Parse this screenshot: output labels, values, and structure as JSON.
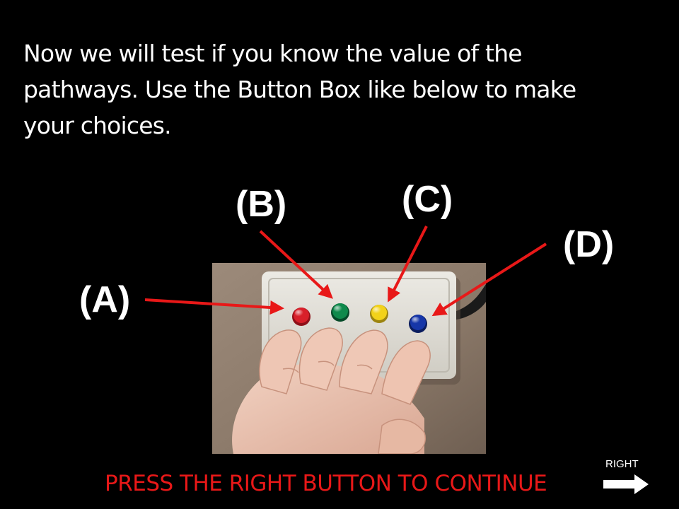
{
  "instructions": {
    "line1": "Now we will test if you know the value of the",
    "line2": "pathways. Use the Button Box like below to make",
    "line3": "your choices."
  },
  "labels": {
    "a": "(A)",
    "b": "(B)",
    "c": "(C)",
    "d": "(D)"
  },
  "button_box": {
    "buttons": [
      {
        "label": "(A)",
        "color": "#d8202a"
      },
      {
        "label": "(B)",
        "color": "#0f8a4c"
      },
      {
        "label": "(C)",
        "color": "#f2d21a"
      },
      {
        "label": "(D)",
        "color": "#1636a8"
      }
    ]
  },
  "footer": {
    "continue_text": "PRESS THE RIGHT BUTTON TO CONTINUE",
    "right_hint": "RIGHT",
    "arrow_icon": "right-arrow-icon"
  },
  "colors": {
    "background": "#000000",
    "text": "#ffffff",
    "accent_red": "#e81818",
    "arrow_red": "#e81818"
  }
}
